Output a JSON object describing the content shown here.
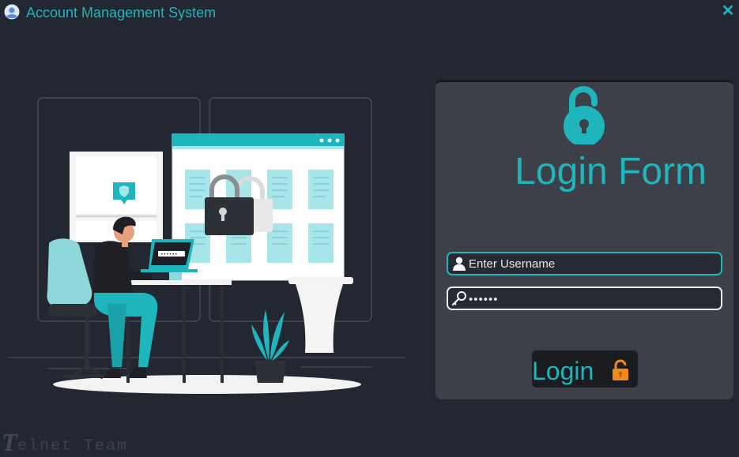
{
  "window": {
    "title": "Account Management System"
  },
  "login": {
    "title": "Login Form",
    "username_placeholder": "Enter Username",
    "password_value": "••••••",
    "button_label": "Login"
  },
  "watermark": {
    "initial": "T",
    "text": "elnet Team"
  },
  "icons": {
    "app": "user-avatar-icon",
    "close": "close-icon",
    "form_lock": "unlocked-padlock-icon",
    "username": "user-icon",
    "password": "key-icon",
    "button": "unlocked-padlock-icon"
  },
  "colors": {
    "accent": "#1fb5bd",
    "background": "#232731",
    "panel": "#3d4049",
    "button_lock": "#f28a1b"
  }
}
